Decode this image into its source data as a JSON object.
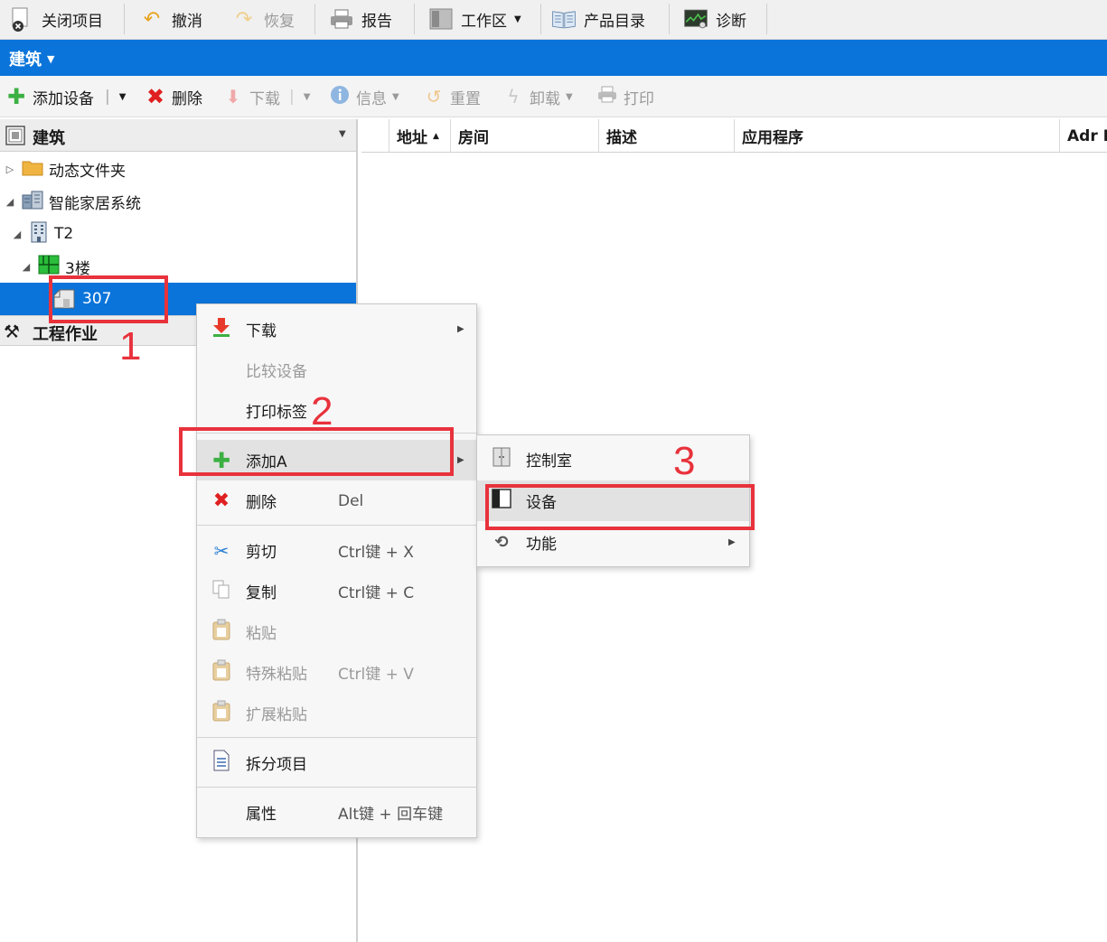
{
  "top_toolbar": {
    "close_project": "关闭项目",
    "undo": "撤消",
    "redo": "恢复",
    "report": "报告",
    "workspace": "工作区",
    "catalog": "产品目录",
    "diagnostics": "诊断"
  },
  "blue_bar": {
    "title": "建筑"
  },
  "sub_toolbar": {
    "add_device": "添加设备",
    "delete": "删除",
    "download": "下载",
    "info": "信息",
    "reset": "重置",
    "unload": "卸载",
    "print": "打印"
  },
  "left_panel": {
    "header": "建筑",
    "tree": {
      "dynamic_folder": "动态文件夹",
      "smart_home": "智能家居系统",
      "building": "T2",
      "floor": "3楼",
      "room": "307"
    },
    "engineering": "工程作业"
  },
  "grid": {
    "columns": [
      "地址",
      "房间",
      "描述",
      "应用程序",
      "Adr P"
    ]
  },
  "context_menu": {
    "items": [
      {
        "label": "下载",
        "shortcut": ""
      },
      {
        "label": "比较设备",
        "shortcut": ""
      },
      {
        "label": "打印标签",
        "shortcut": ""
      },
      {
        "label": "添加A",
        "shortcut": ""
      },
      {
        "label": "删除",
        "shortcut": "Del"
      },
      {
        "label": "剪切",
        "shortcut": "Ctrl键 + X"
      },
      {
        "label": "复制",
        "shortcut": "Ctrl键 + C"
      },
      {
        "label": "粘贴",
        "shortcut": ""
      },
      {
        "label": "特殊粘贴",
        "shortcut": "Ctrl键 + V"
      },
      {
        "label": "扩展粘贴",
        "shortcut": ""
      },
      {
        "label": "拆分项目",
        "shortcut": ""
      },
      {
        "label": "属性",
        "shortcut": "Alt键 + 回车键"
      }
    ]
  },
  "sub_menu": {
    "items": [
      {
        "label": "控制室"
      },
      {
        "label": "设备"
      },
      {
        "label": "功能"
      }
    ]
  },
  "annotations": {
    "step1": "1",
    "step2": "2",
    "step3": "3"
  },
  "colors": {
    "accent": "#0a74da",
    "annotation": "#e8323c"
  }
}
